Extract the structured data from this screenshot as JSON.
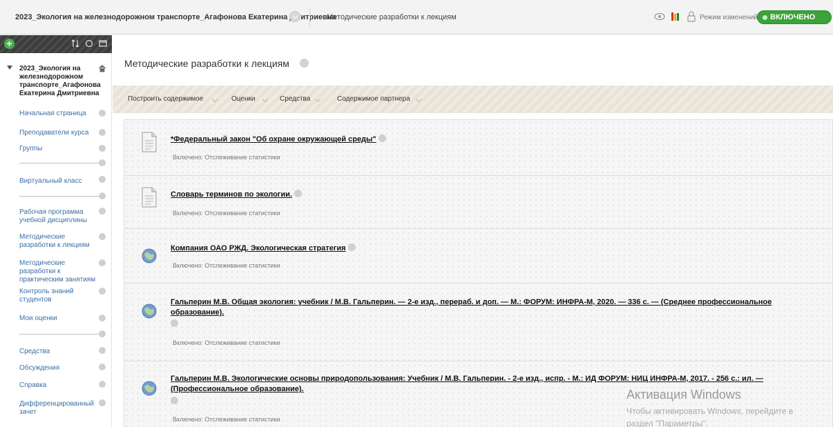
{
  "topbar": {
    "course_crumb": "2023_Экология на железнодорожном транспорте_Агафонова Екатерина Дмитриевна",
    "page_crumb": "Методические разработки к лекциям",
    "edit_mode_label": "Режим изменений:",
    "edit_mode_state": "ВКЛЮЧЕНО",
    "icons": [
      "eye-icon",
      "library-icon",
      "lock-icon"
    ]
  },
  "sidebar": {
    "course_title": "2023_Экология на железнодорожном транспорте_Агафонова Екатерина Дмитриевна",
    "items": [
      {
        "label": "Начальная страница"
      },
      {
        "label": "Преподаватели курса"
      },
      {
        "label": "Группы"
      },
      {
        "label": "Виртуальный класс"
      },
      {
        "label": "Рабочая программа учебной дисциплины"
      },
      {
        "label": "Методические разработки к лекциям"
      },
      {
        "label": "Методические разработки к практическим занятиям"
      },
      {
        "label": "Контроль знаний студентов"
      },
      {
        "label": "Мои оценки"
      },
      {
        "label": "Средства"
      },
      {
        "label": "Обсуждения"
      },
      {
        "label": "Справка"
      },
      {
        "label": "Дифференцированный зачет"
      }
    ]
  },
  "main": {
    "page_title": "Методические разработки к лекциям",
    "actions": [
      {
        "label": "Построить содержимое"
      },
      {
        "label": "Оценки"
      },
      {
        "label": "Средства"
      },
      {
        "label": "Содержимое партнера"
      }
    ],
    "items": [
      {
        "title": "*Федеральный закон \"Об охране окружающей среды\"",
        "meta": "Включено:  Отслеживание статистики",
        "icon": "document-icon"
      },
      {
        "title": "Словарь терминов по экологии.",
        "meta": "Включено:  Отслеживание статистики",
        "icon": "document-icon"
      },
      {
        "title": "Компания ОАО РЖД. Экологическая стратегия",
        "meta": "Включено:  Отслеживание статистики",
        "icon": "globe-link-icon"
      },
      {
        "title": "Гальперин М.В. Общая экология: учебник / М.В. Гальперин. — 2-е изд., перераб. и доп. — М.: ФОРУМ: ИНФРА-М, 2020. — 336 с. — (Среднее профессиональное образование).",
        "meta": "Включено:  Отслеживание статистики",
        "icon": "globe-link-icon"
      },
      {
        "title": "Гальперин М.В. Экологические основы природопользования: Учебник / М.В. Гальперин. - 2-е изд., испр. - М.: ИД ФОРУМ: НИЦ ИНФРА-М, 2017. - 256 с.: ил. — (Профессиональное образование).",
        "meta": "Включено:  Отслеживание статистики",
        "icon": "globe-link-icon"
      }
    ]
  },
  "watermark": {
    "title": "Активация Windows",
    "line1": "Чтобы активировать Windows, перейдите в",
    "line2": "раздел \"Параметры\"."
  }
}
